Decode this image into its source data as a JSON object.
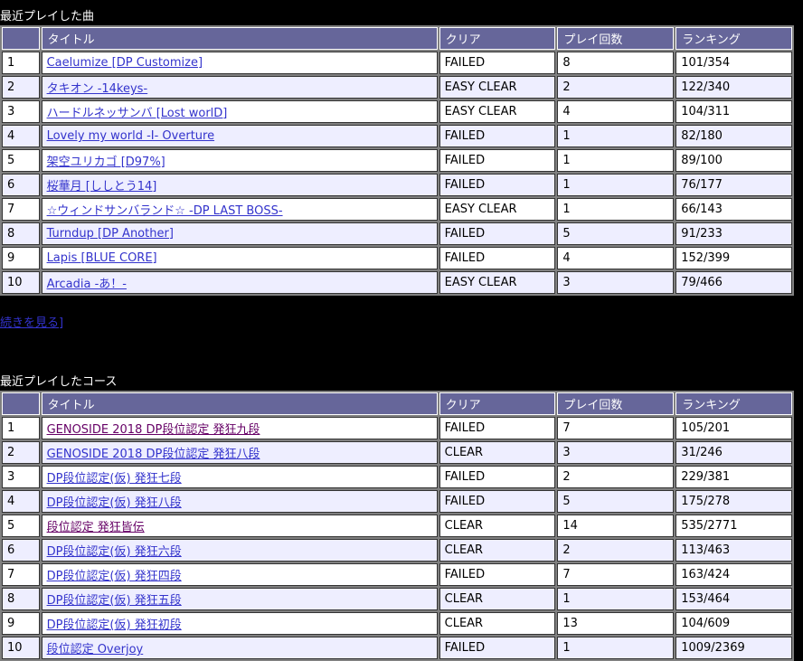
{
  "recent_songs": {
    "title": "最近プレイした曲",
    "headers": [
      "",
      "タイトル",
      "クリア",
      "プレイ回数",
      "ランキング"
    ],
    "rows": [
      {
        "num": "1",
        "title": "Caelumize [DP Customize]",
        "clear": "FAILED",
        "plays": "8",
        "rank": "101/354"
      },
      {
        "num": "2",
        "title": "タキオン -14keys-",
        "clear": "EASY CLEAR",
        "plays": "2",
        "rank": "122/340"
      },
      {
        "num": "3",
        "title": "ハードルネッサンバ [Lost worlD]",
        "clear": "EASY CLEAR",
        "plays": "4",
        "rank": "104/311"
      },
      {
        "num": "4",
        "title": "Lovely my world -I- Overture",
        "clear": "FAILED",
        "plays": "1",
        "rank": "82/180"
      },
      {
        "num": "5",
        "title": "架空ユリカゴ [D97%]",
        "clear": "FAILED",
        "plays": "1",
        "rank": "89/100"
      },
      {
        "num": "6",
        "title": "桜華月 [ししとう14]",
        "clear": "FAILED",
        "plays": "1",
        "rank": "76/177"
      },
      {
        "num": "7",
        "title": "☆ウィンドサンバランド☆ -DP LAST BOSS-",
        "clear": "EASY CLEAR",
        "plays": "1",
        "rank": "66/143"
      },
      {
        "num": "8",
        "title": "Turndup [DP Another]",
        "clear": "FAILED",
        "plays": "5",
        "rank": "91/233"
      },
      {
        "num": "9",
        "title": "Lapis [BLUE CORE]",
        "clear": "FAILED",
        "plays": "4",
        "rank": "152/399"
      },
      {
        "num": "10",
        "title": "Arcadia -あ！-",
        "clear": "EASY CLEAR",
        "plays": "3",
        "rank": "79/466"
      }
    ]
  },
  "more_link": "続きを見る]",
  "recent_courses": {
    "title": "最近プレイしたコース",
    "headers": [
      "",
      "タイトル",
      "クリア",
      "プレイ回数",
      "ランキング"
    ],
    "rows": [
      {
        "num": "1",
        "title": "GENOSIDE 2018 DP段位認定 発狂九段",
        "clear": "FAILED",
        "plays": "7",
        "rank": "105/201",
        "visited": true
      },
      {
        "num": "2",
        "title": "GENOSIDE 2018 DP段位認定 発狂八段",
        "clear": "CLEAR",
        "plays": "3",
        "rank": "31/246",
        "visited": false
      },
      {
        "num": "3",
        "title": "DP段位認定(仮) 発狂七段",
        "clear": "FAILED",
        "plays": "2",
        "rank": "229/381",
        "visited": false
      },
      {
        "num": "4",
        "title": "DP段位認定(仮) 発狂八段",
        "clear": "FAILED",
        "plays": "5",
        "rank": "175/278",
        "visited": false
      },
      {
        "num": "5",
        "title": "段位認定 発狂皆伝",
        "clear": "CLEAR",
        "plays": "14",
        "rank": "535/2771",
        "visited": true
      },
      {
        "num": "6",
        "title": "DP段位認定(仮) 発狂六段",
        "clear": "CLEAR",
        "plays": "2",
        "rank": "113/463",
        "visited": false
      },
      {
        "num": "7",
        "title": "DP段位認定(仮) 発狂四段",
        "clear": "FAILED",
        "plays": "7",
        "rank": "163/424",
        "visited": false
      },
      {
        "num": "8",
        "title": "DP段位認定(仮) 発狂五段",
        "clear": "CLEAR",
        "plays": "1",
        "rank": "153/464",
        "visited": false
      },
      {
        "num": "9",
        "title": "DP段位認定(仮) 発狂初段",
        "clear": "CLEAR",
        "plays": "13",
        "rank": "104/609",
        "visited": false
      },
      {
        "num": "10",
        "title": "段位認定 Overjoy",
        "clear": "FAILED",
        "plays": "1",
        "rank": "1009/2369",
        "visited": false
      }
    ]
  }
}
